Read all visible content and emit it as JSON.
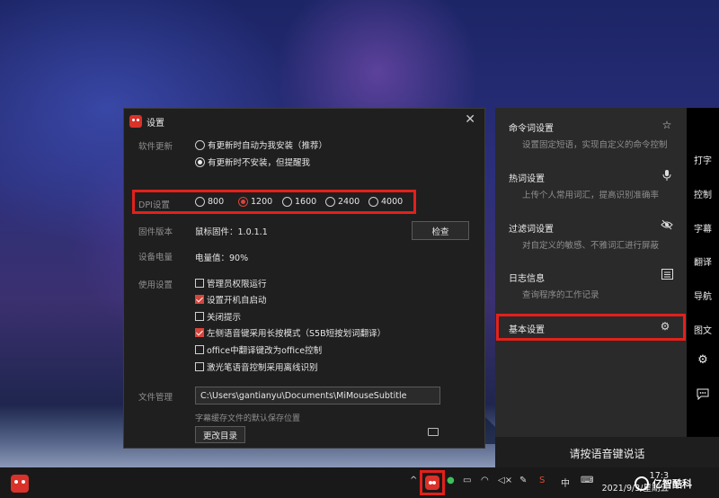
{
  "dialog": {
    "title": "设置",
    "close": "✕",
    "software_update": {
      "label": "软件更新",
      "option_auto": "有更新时自动为我安装（推荐）",
      "option_notify": "有更新时不安装，但提醒我"
    },
    "dpi": {
      "label": "DPI设置",
      "options": [
        "800",
        "1200",
        "1600",
        "2400",
        "4000"
      ],
      "selected": "1200"
    },
    "firmware": {
      "label": "固件版本",
      "value": "鼠标固件：1.0.1.1",
      "check_button": "检查"
    },
    "battery": {
      "label": "设备电量",
      "value": "电量值：90%"
    },
    "usage": {
      "label": "使用设置",
      "options": [
        {
          "text": "管理员权限运行",
          "checked": false
        },
        {
          "text": "设置开机自启动",
          "checked": true
        },
        {
          "text": "关闭提示",
          "checked": false
        },
        {
          "text": "左侧语音键采用长按模式（S5B短按划词翻译）",
          "checked": true
        },
        {
          "text": "office中翻译键改为office控制",
          "checked": false
        },
        {
          "text": "激光笔语音控制采用离线识别",
          "checked": false
        }
      ]
    },
    "files": {
      "label": "文件管理",
      "path": "C:\\Users\\gantianyu\\Documents\\MiMouseSubtitle",
      "hint": "字幕缓存文件的默认保存位置",
      "change_button": "更改目录"
    }
  },
  "panel": {
    "items": [
      {
        "title": "命令词设置",
        "subtitle": "设置固定短语，实现自定义的命令控制",
        "icon": "star-icon"
      },
      {
        "title": "热词设置",
        "subtitle": "上传个人常用词汇，提高识别准确率",
        "icon": "microphone-icon"
      },
      {
        "title": "过滤词设置",
        "subtitle": "对自定义的敏感、不雅词汇进行屏蔽",
        "icon": "eye-off-icon"
      },
      {
        "title": "日志信息",
        "subtitle": "查询程序的工作记录",
        "icon": "log-icon"
      },
      {
        "title": "基本设置",
        "subtitle": "",
        "icon": "gear-icon"
      }
    ],
    "footer": "请按语音键说话"
  },
  "sidebar": {
    "items": [
      "打字",
      "控制",
      "字幕",
      "翻译",
      "导航",
      "图文"
    ]
  },
  "taskbar": {
    "tray_lang": "中",
    "time": "17:3",
    "date": "2021/9/3/星期五"
  },
  "watermark": "亿智酷科",
  "colors": {
    "accent": "#d6453c",
    "highlight": "#e3201b"
  }
}
